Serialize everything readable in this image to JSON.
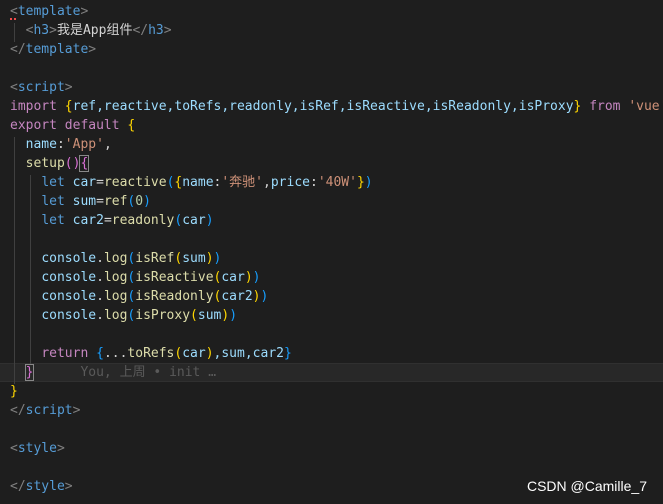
{
  "code": {
    "l1": {
      "lt": "<",
      "tag": "template",
      "gt": ">"
    },
    "l2": {
      "lt": "<",
      "tag": "h3",
      "gt": ">",
      "text": "我是App组件",
      "lt2": "</",
      "tag2": "h3",
      "gt2": ">"
    },
    "l3": {
      "lt": "</",
      "tag": "template",
      "gt": ">"
    },
    "l5": {
      "lt": "<",
      "tag": "script",
      "gt": ">"
    },
    "l6": {
      "kw1": "import",
      "ob": "{",
      "items": "ref,reactive,toRefs,readonly,isRef,isReactive,isReadonly,isProxy",
      "cb": "}",
      "kw2": "from",
      "str": "'vue'"
    },
    "l7": {
      "kw1": "export",
      "kw2": "default",
      "ob": "{"
    },
    "l8": {
      "key": "name",
      "colon": ":",
      "str": "'App'",
      "comma": ","
    },
    "l9": {
      "fn": "setup",
      "op": "()",
      "ob": "{"
    },
    "l10": {
      "let": "let",
      "var": "car",
      "eq": "=",
      "fn": "reactive",
      "op": "(",
      "ob": "{",
      "k1": "name",
      "c1": ":",
      "s1": "'奔驰'",
      "comma": ",",
      "k2": "price",
      "c2": ":",
      "s2": "'40W'",
      "cb": "}",
      "cp": ")"
    },
    "l11": {
      "let": "let",
      "var": "sum",
      "eq": "=",
      "fn": "ref",
      "op": "(",
      "num": "0",
      "cp": ")"
    },
    "l12": {
      "let": "let",
      "var": "car2",
      "eq": "=",
      "fn": "readonly",
      "op": "(",
      "arg": "car",
      "cp": ")"
    },
    "l14": {
      "obj": "console",
      "dot": ".",
      "fn": "log",
      "op": "(",
      "fn2": "isRef",
      "op2": "(",
      "arg": "sum",
      "cp2": ")",
      "cp": ")"
    },
    "l15": {
      "obj": "console",
      "dot": ".",
      "fn": "log",
      "op": "(",
      "fn2": "isReactive",
      "op2": "(",
      "arg": "car",
      "cp2": ")",
      "cp": ")"
    },
    "l16": {
      "obj": "console",
      "dot": ".",
      "fn": "log",
      "op": "(",
      "fn2": "isReadonly",
      "op2": "(",
      "arg": "car2",
      "cp2": ")",
      "cp": ")"
    },
    "l17": {
      "obj": "console",
      "dot": ".",
      "fn": "log",
      "op": "(",
      "fn2": "isProxy",
      "op2": "(",
      "arg": "sum",
      "cp2": ")",
      "cp": ")"
    },
    "l19": {
      "kw": "return",
      "ob": "{",
      "spread": "...",
      "fn": "toRefs",
      "op": "(",
      "arg": "car",
      "cp": ")",
      "rest": ",sum,car2",
      "cb": "}"
    },
    "l20": {
      "cb": "}",
      "blame": "You, 上周 • init …"
    },
    "l21": {
      "cb": "}"
    },
    "l22": {
      "lt": "</",
      "tag": "script",
      "gt": ">"
    },
    "l24": {
      "lt": "<",
      "tag": "style",
      "gt": ">"
    },
    "l26": {
      "lt": "</",
      "tag": "style",
      "gt": ">"
    }
  },
  "watermark": "CSDN @Camille_7"
}
